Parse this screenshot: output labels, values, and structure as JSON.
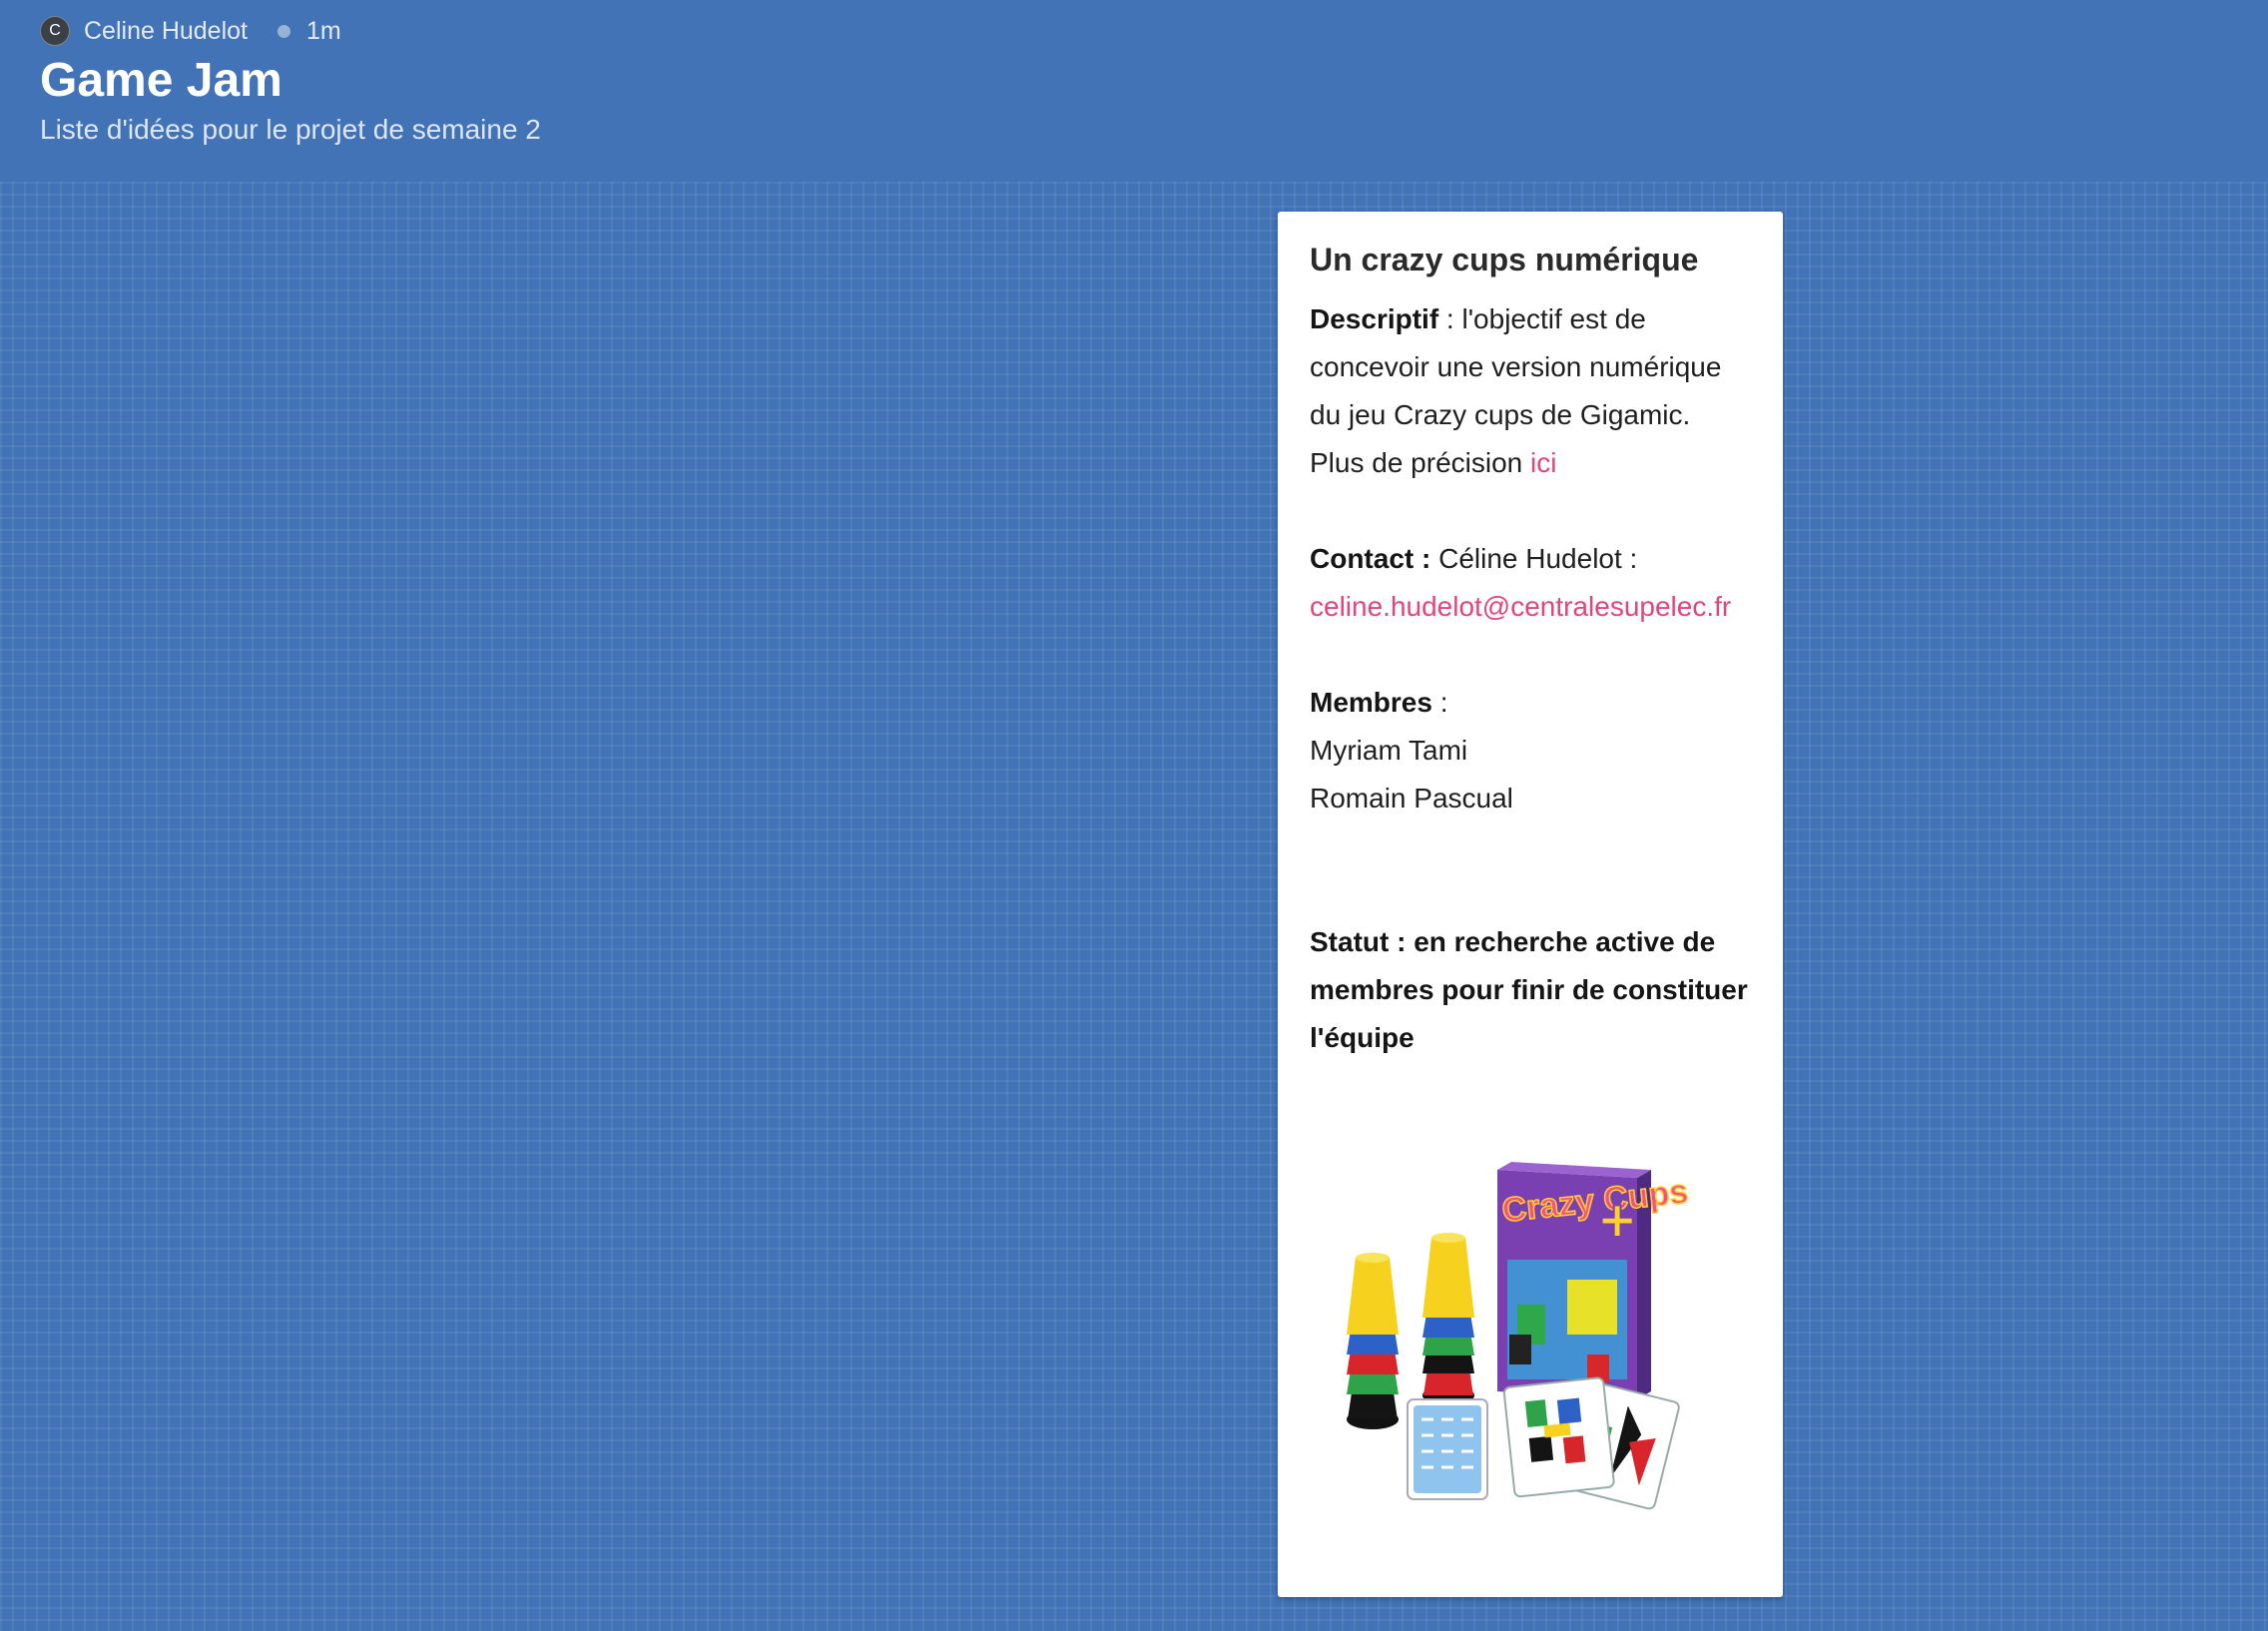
{
  "post": {
    "author_initial": "C",
    "author": "Celine Hudelot",
    "time": "1m",
    "title": "Game Jam",
    "subtitle": "Liste d'idées pour le projet de semaine 2"
  },
  "card": {
    "title": "Un crazy cups numérique",
    "desc_label": "Descriptif",
    "desc_text": " : l'objectif est de concevoir une version numérique du jeu Crazy cups de Gigamic. Plus de précision ",
    "desc_link": "ici",
    "contact_label": "Contact :",
    "contact_text": " Céline Hudelot :",
    "contact_email": "celine.hudelot@centralesupelec.fr",
    "members_label": "Membres",
    "members_suffix": " :",
    "members": [
      "Myriam Tami",
      "Romain Pascual"
    ],
    "status": "Statut : en recherche active de membres pour finir de constituer l'équipe",
    "image_box_text": "Crazy Cups",
    "image_box_plus": "+"
  },
  "colors": {
    "background": "#4273b6",
    "link": "#e2457c",
    "card": "#ffffff"
  }
}
